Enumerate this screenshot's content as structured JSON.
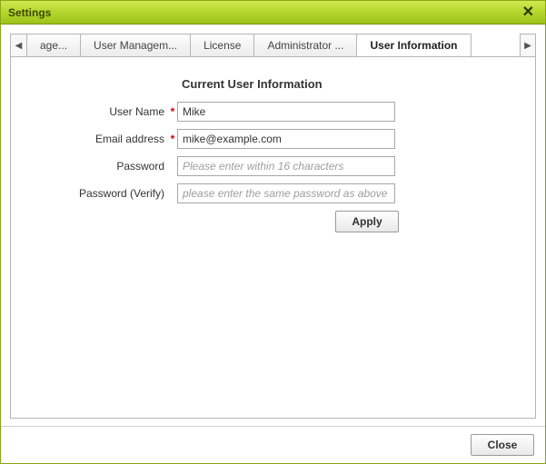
{
  "window": {
    "title": "Settings",
    "close_label": "✕"
  },
  "tabs": {
    "scroll_left": "◀",
    "scroll_right": "▶",
    "items": [
      {
        "label": "age...",
        "active": false
      },
      {
        "label": "User Managem...",
        "active": false
      },
      {
        "label": "License",
        "active": false
      },
      {
        "label": "Administrator ...",
        "active": false
      },
      {
        "label": "User Information",
        "active": true
      }
    ]
  },
  "form": {
    "heading": "Current User Information",
    "fields": {
      "username": {
        "label": "User Name",
        "required": "*",
        "value": "Mike",
        "placeholder": ""
      },
      "email": {
        "label": "Email address",
        "required": "*",
        "value": "mike@example.com",
        "placeholder": ""
      },
      "password": {
        "label": "Password",
        "required": "",
        "value": "",
        "placeholder": "Please enter within 16 characters"
      },
      "password_verify": {
        "label": "Password (Verify)",
        "required": "",
        "value": "",
        "placeholder": "please enter the same password as above"
      }
    },
    "apply_label": "Apply"
  },
  "footer": {
    "close_label": "Close"
  }
}
